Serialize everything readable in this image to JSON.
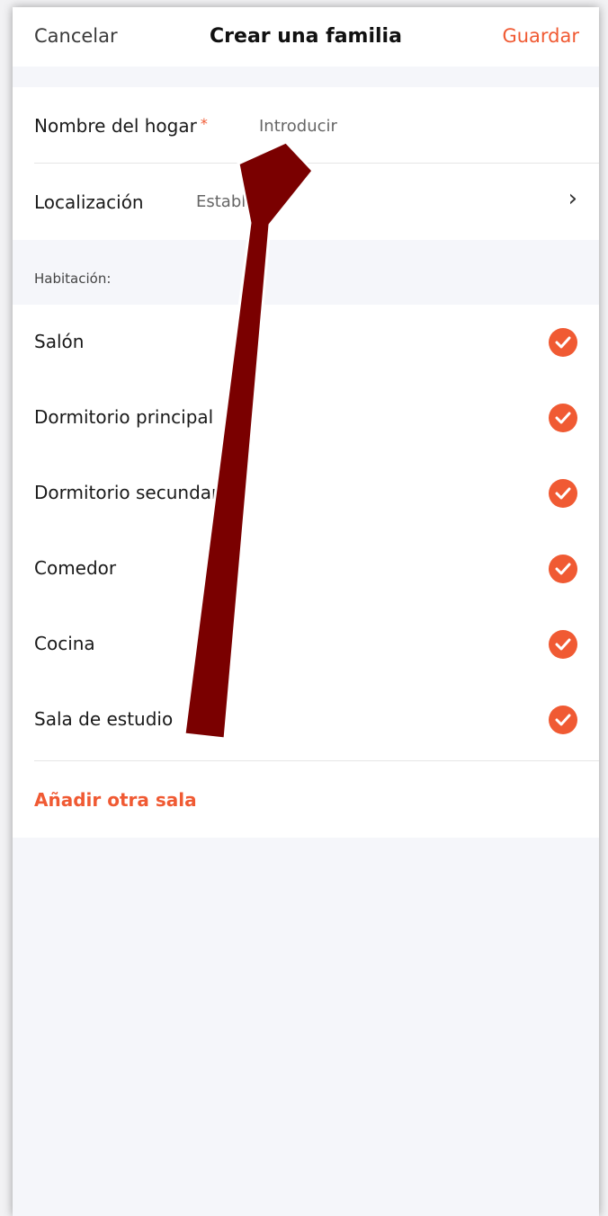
{
  "header": {
    "cancel_label": "Cancelar",
    "title": "Crear una familia",
    "save_label": "Guardar"
  },
  "form": {
    "home_name_label": "Nombre del hogar",
    "required_mark": "*",
    "home_name_placeholder": "Introducir",
    "location_label": "Localización",
    "location_value": "Establecer",
    "location_chevron": "›"
  },
  "rooms": {
    "section_label": "Habitación:",
    "items": [
      {
        "name": "Salón",
        "checked": true
      },
      {
        "name": "Dormitorio principal",
        "checked": true
      },
      {
        "name": "Dormitorio secundario",
        "checked": true
      },
      {
        "name": "Comedor",
        "checked": true
      },
      {
        "name": "Cocina",
        "checked": true
      },
      {
        "name": "Sala de estudio",
        "checked": true
      }
    ],
    "add_room_label": "Añadir otra sala"
  },
  "colors": {
    "accent": "#f05a33",
    "annotation_arrow": "#7a0000"
  },
  "icons": {
    "check": "check-icon",
    "chevron": "chevron-right-icon",
    "annotation": "annotation-arrow"
  }
}
